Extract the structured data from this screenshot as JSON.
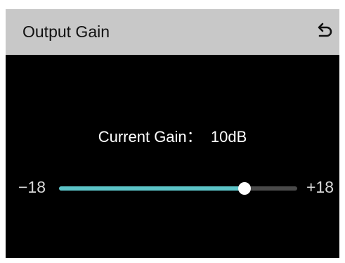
{
  "header": {
    "title": "Output Gain",
    "back_icon": "undo-arrow-icon"
  },
  "gain": {
    "label": "Current Gain：",
    "value": "10dB",
    "display": "Current Gain：  10dB"
  },
  "slider": {
    "min_label": "−18",
    "max_label": "+18",
    "min": -18,
    "max": 18,
    "value": 10,
    "fill_color": "#5cc4c8",
    "track_color": "#4a4a4a",
    "thumb_color": "#ffffff"
  },
  "colors": {
    "header_bg": "#c8c8c8",
    "screen_bg": "#000000"
  }
}
